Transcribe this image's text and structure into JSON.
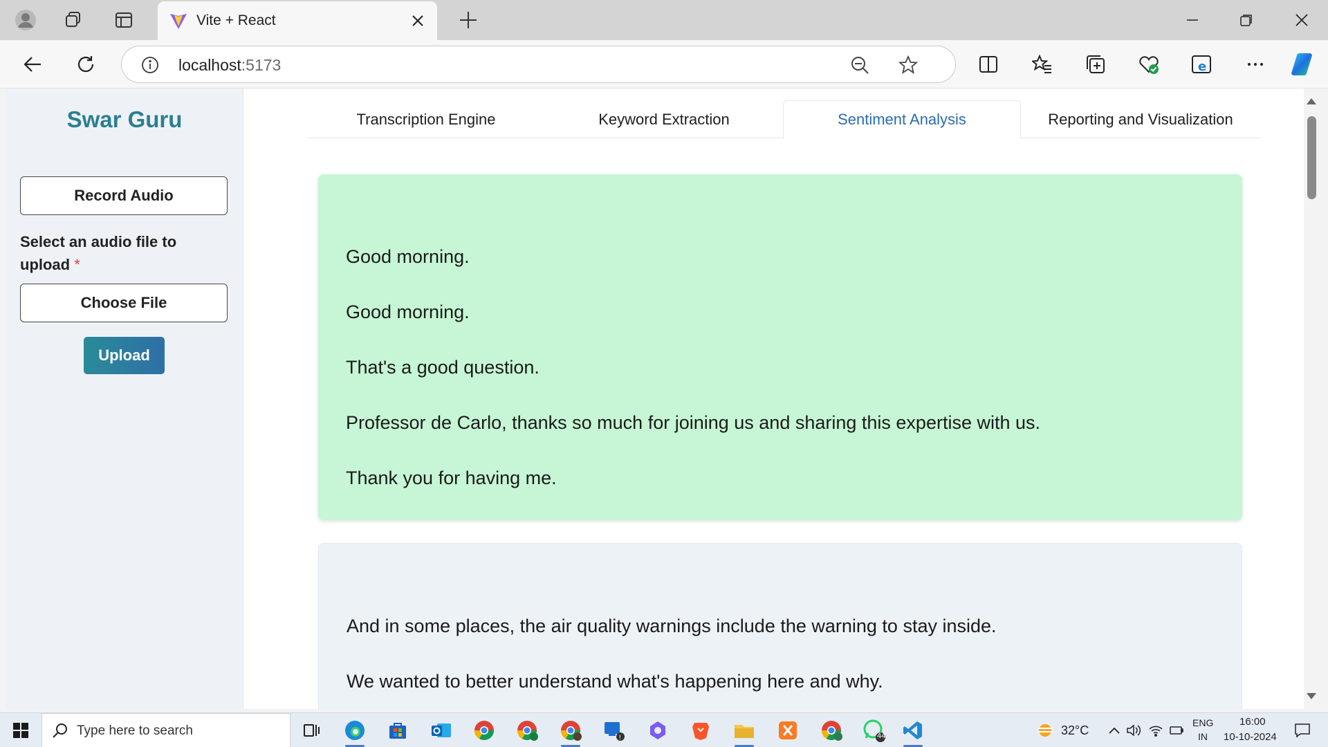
{
  "browser": {
    "tab_title": "Vite + React",
    "url_host": "localhost",
    "url_port": ":5173"
  },
  "app": {
    "brand": "Swar Guru",
    "record_button": "Record Audio",
    "select_label": "Select an audio file to upload",
    "required_mark": "*",
    "choose_file_button": "Choose File",
    "upload_button": "Upload"
  },
  "tabs": [
    {
      "label": "Transcription Engine"
    },
    {
      "label": "Keyword Extraction"
    },
    {
      "label": "Sentiment Analysis"
    },
    {
      "label": "Reporting and Visualization"
    }
  ],
  "selected_tab": "Sentiment Analysis",
  "cards": [
    {
      "sentiment_color": "#c6f6d5",
      "lines": [
        "Good morning.",
        "Good morning.",
        "That's a good question.",
        "Professor de Carlo, thanks so much for joining us and sharing this expertise with us.",
        "Thank you for having me."
      ]
    },
    {
      "sentiment_color": "#edf2f7",
      "lines": [
        "And in some places, the air quality warnings include the warning to stay inside.",
        "We wanted to better understand what's happening here and why."
      ]
    }
  ],
  "taskbar": {
    "search_placeholder": "Type here to search",
    "weather": "32°C",
    "lang_1": "ENG",
    "lang_2": "IN",
    "time": "16:00",
    "date": "10-10-2024",
    "whatsapp_badge": "44"
  },
  "colors": {
    "brand": "#2b7f91",
    "accent": "#2b6cb0",
    "positive_card": "#c6f6d5",
    "neutral_card": "#edf2f7"
  }
}
